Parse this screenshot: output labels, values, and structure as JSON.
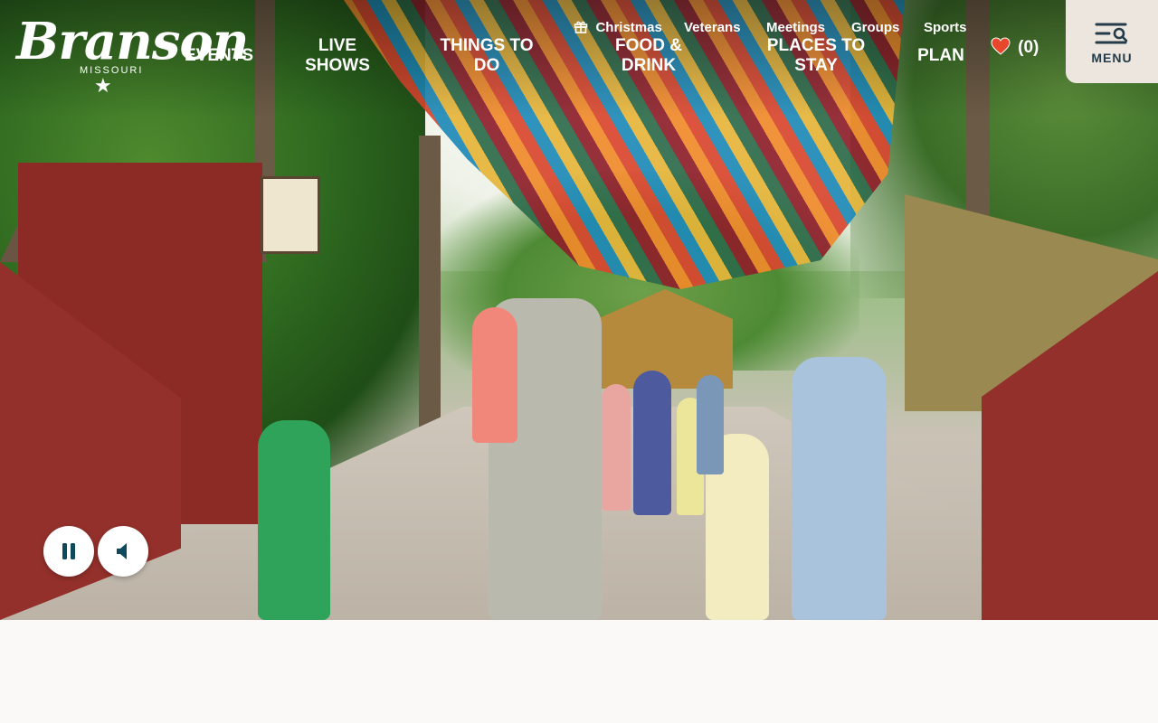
{
  "logo": {
    "name": "Branson",
    "sub": "MISSOURI",
    "star": "★"
  },
  "utility_nav": [
    {
      "label": "Christmas",
      "icon": "gift-icon"
    },
    {
      "label": "Veterans"
    },
    {
      "label": "Meetings"
    },
    {
      "label": "Groups"
    },
    {
      "label": "Sports"
    }
  ],
  "main_nav": [
    {
      "line1": "EVENTS",
      "line2": ""
    },
    {
      "line1": "LIVE",
      "line2": "SHOWS"
    },
    {
      "line1": "THINGS TO",
      "line2": "DO"
    },
    {
      "line1": "FOOD &",
      "line2": "DRINK"
    },
    {
      "line1": "PLACES TO",
      "line2": "STAY"
    },
    {
      "line1": "PLAN",
      "line2": ""
    }
  ],
  "favorites": {
    "count_label": "(0)",
    "icon": "heart-icon",
    "color": "#e8472b"
  },
  "menu": {
    "label": "MENU",
    "icon": "menu-search-icon"
  },
  "video_controls": {
    "pause_icon": "pause-icon",
    "mute_icon": "speaker-icon",
    "accent": "#0f4a5c"
  },
  "colors": {
    "menu_bg": "#ece6de",
    "page_bg": "#faf9f7",
    "nav_text": "#ffffff"
  }
}
